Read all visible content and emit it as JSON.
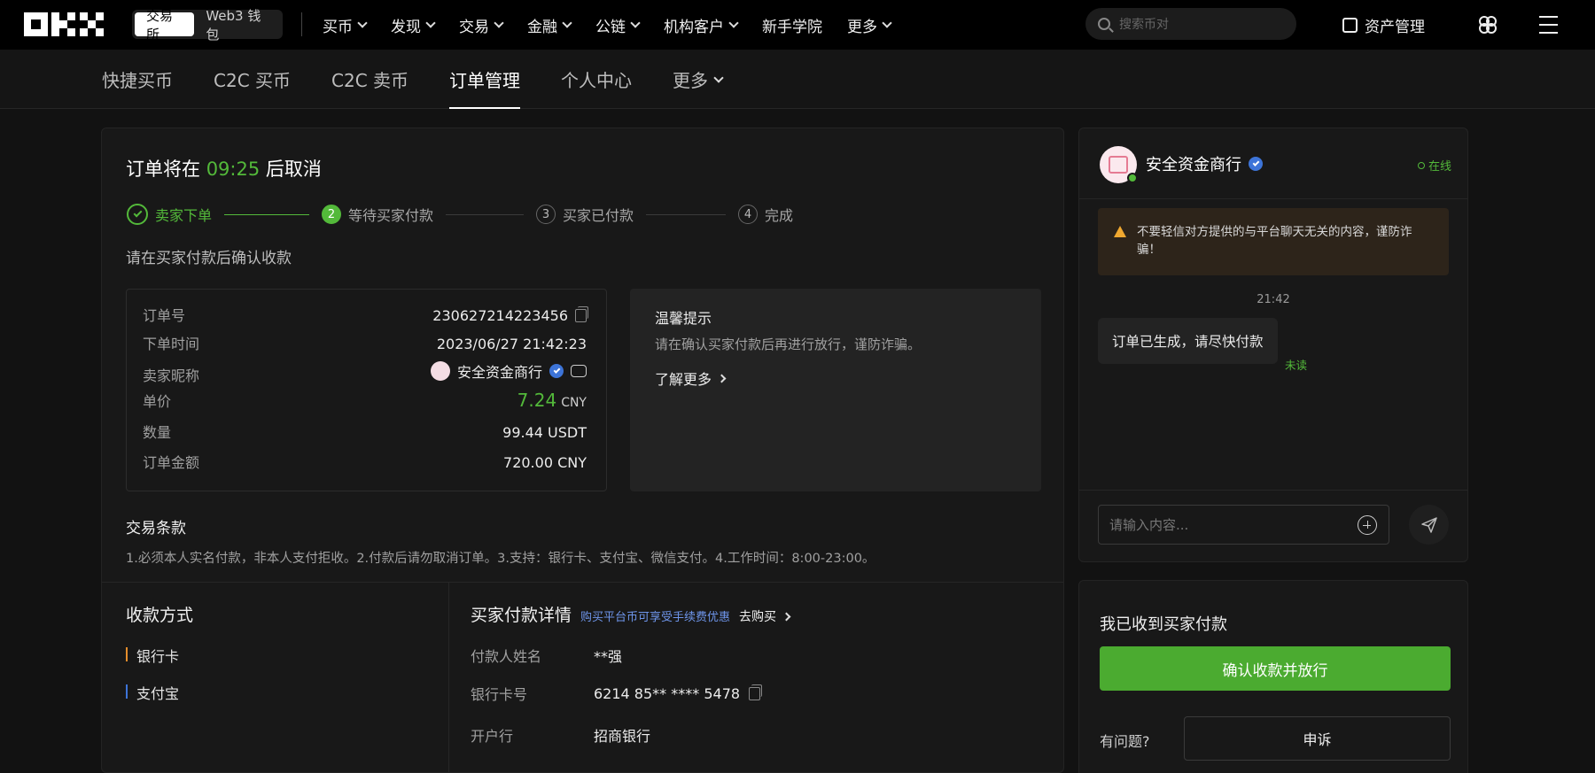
{
  "nav": {
    "segment": [
      "交易所",
      "Web3 钱包"
    ],
    "menu": [
      "买币",
      "发现",
      "交易",
      "金融",
      "公链",
      "机构客户",
      "新手学院",
      "更多"
    ],
    "search_placeholder": "搜索币对",
    "assets_label": "资产管理"
  },
  "subnav": {
    "tabs": [
      "快捷买币",
      "C2C 买币",
      "C2C 卖币",
      "订单管理",
      "个人中心",
      "更多"
    ],
    "active": "订单管理"
  },
  "order": {
    "title_prefix": "订单将在",
    "countdown": "09:25",
    "title_suffix": "后取消",
    "steps": [
      {
        "num": "",
        "label": "卖家下单"
      },
      {
        "num": "2",
        "label": "等待买家付款"
      },
      {
        "num": "3",
        "label": "买家已付款"
      },
      {
        "num": "4",
        "label": "完成"
      }
    ],
    "hint": "请在买家付款后确认收款",
    "details": {
      "order_no_label": "订单号",
      "order_no": "230627214223456",
      "time_label": "下单时间",
      "time": "2023/06/27 21:42:23",
      "seller_label": "卖家昵称",
      "seller": "安全资金商行",
      "price_label": "单价",
      "price": "7.24",
      "price_unit": "CNY",
      "qty_label": "数量",
      "qty": "99.44 USDT",
      "amount_label": "订单金额",
      "amount": "720.00 CNY"
    },
    "tips": {
      "title": "温馨提示",
      "body": "请在确认买家付款后再进行放行，谨防诈骗。",
      "link": "了解更多"
    },
    "terms": {
      "title": "交易条款",
      "body": "1.必须本人实名付款，非本人支付拒收。2.付款后请勿取消订单。3.支持：银行卡、支付宝、微信支付。4.工作时间：8:00-23:00。"
    },
    "payment_methods": {
      "title": "收款方式",
      "items": [
        "银行卡",
        "支付宝"
      ]
    },
    "buyer_payment": {
      "title": "买家付款详情",
      "promo": "购买平台币可享受手续费优惠",
      "go": "去购买",
      "name_label": "付款人姓名",
      "name": "**强",
      "card_label": "银行卡号",
      "card": "6214 85** **** 5478",
      "bank_label": "开户行",
      "bank": "招商银行"
    }
  },
  "chat": {
    "merchant": "安全资金商行",
    "status": "在线",
    "warning": "不要轻信对方提供的与平台聊天无关的内容，谨防诈骗！",
    "time": "21:42",
    "message": "订单已生成，请尽快付款",
    "unread": "未读",
    "input_placeholder": "请输入内容..."
  },
  "action": {
    "title": "我已收到买家付款",
    "confirm": "确认收款并放行",
    "question": "有问题?",
    "appeal": "申诉"
  },
  "colors": {
    "accent_green": "#53b93a",
    "confirm_green": "#4bab30",
    "verified_blue": "#3d74d8",
    "warning_bg": "#2d241a"
  }
}
